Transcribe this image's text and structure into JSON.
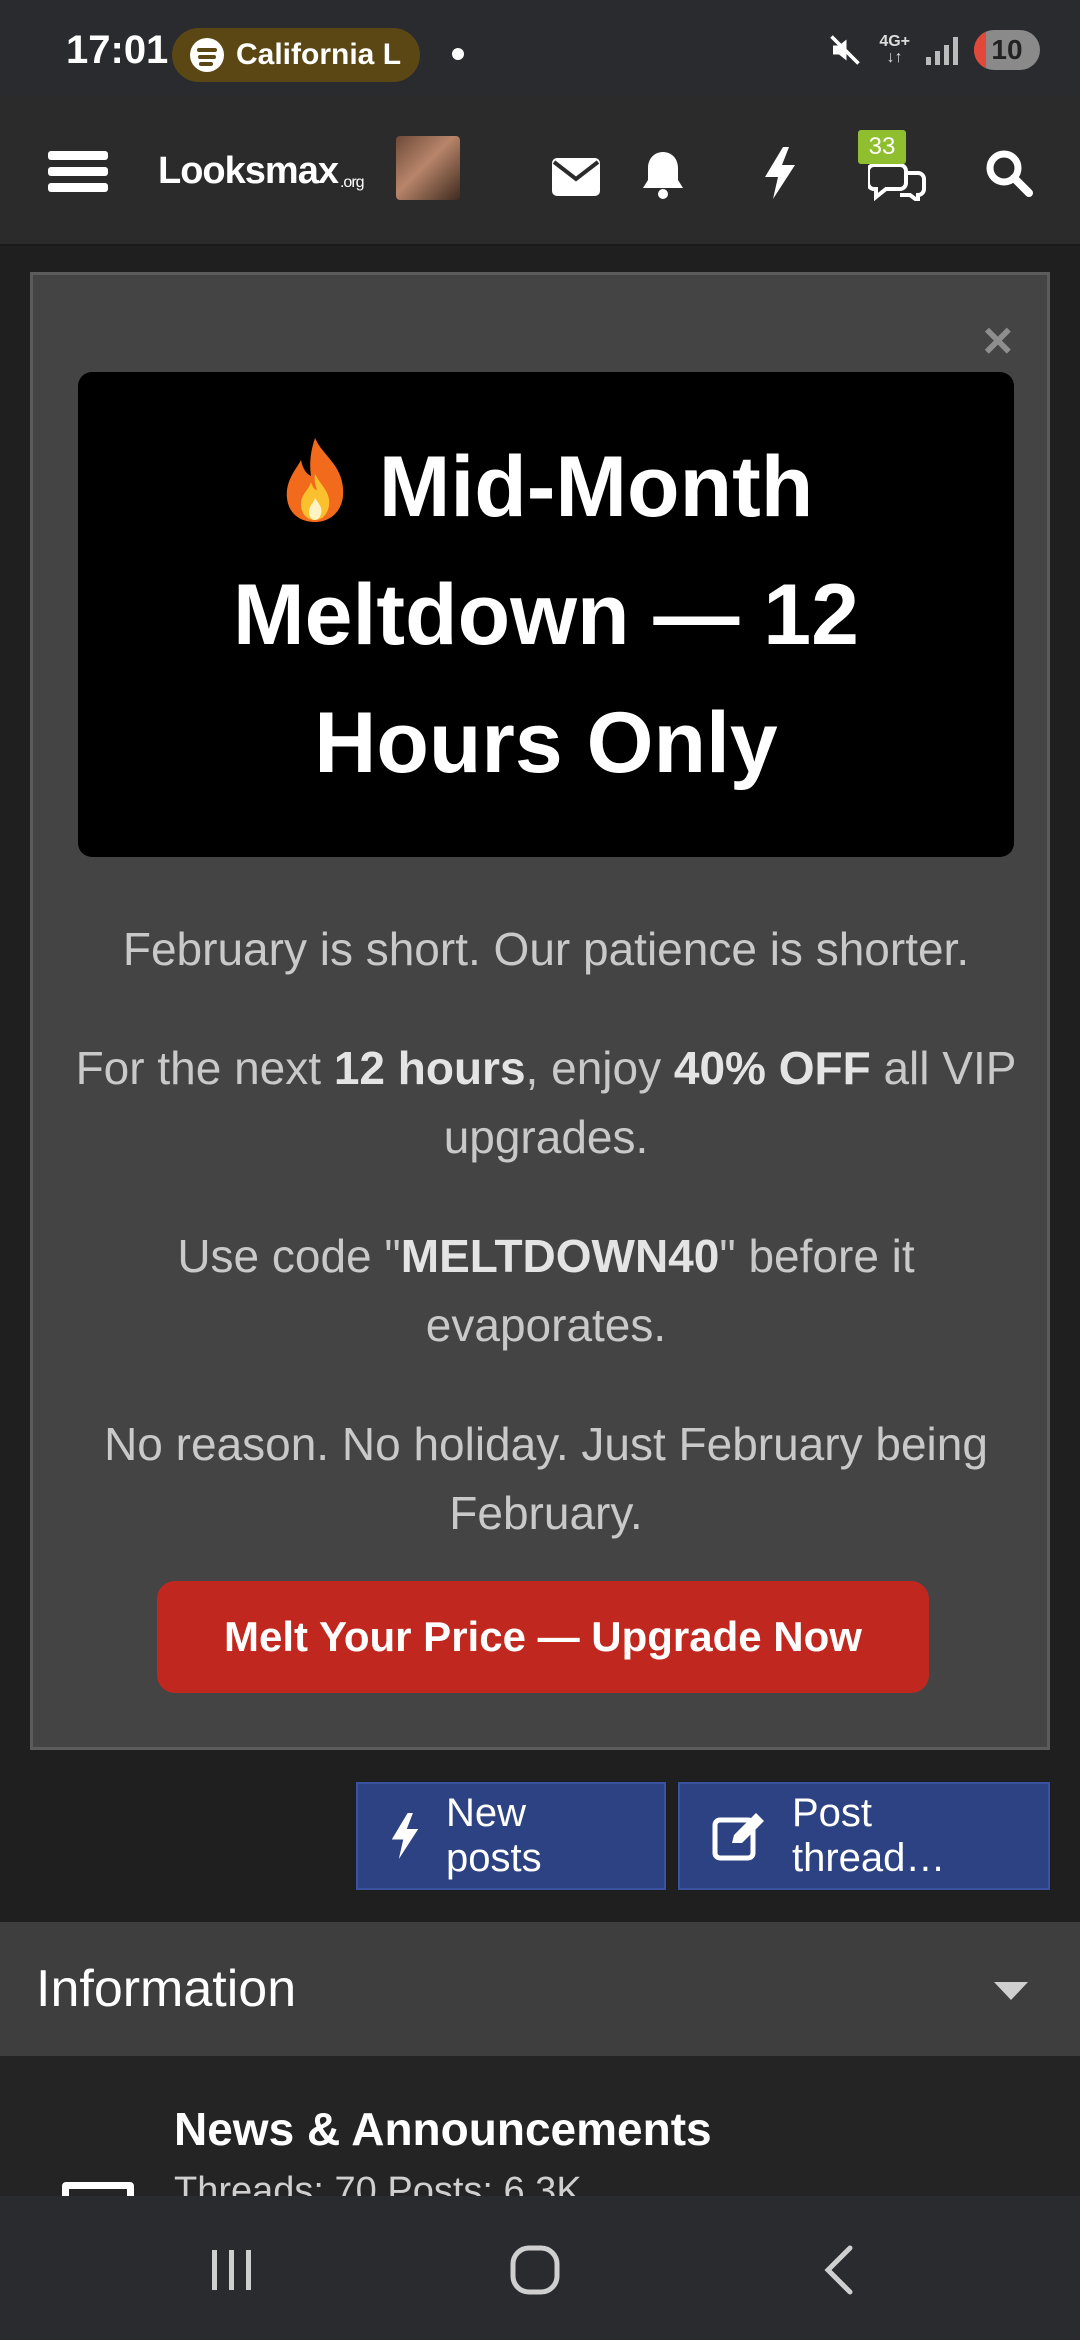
{
  "status_bar": {
    "time": "17:01",
    "now_playing": "California L",
    "network": "4G+",
    "battery": "10"
  },
  "nav": {
    "logo_text": "Looksmax",
    "logo_suffix": ".org",
    "messages_badge": "33",
    "icons": [
      "menu-icon",
      "envelope-icon",
      "bell-icon",
      "lightning-icon",
      "conversations-icon",
      "search-icon"
    ]
  },
  "promo": {
    "title": "Mid-Month Meltdown — 12 Hours Only",
    "line1": "February is short. Our patience is shorter.",
    "line2_pre": "For the next ",
    "line2_hours": "12 hours",
    "line2_mid": ", enjoy ",
    "line2_discount": "40% OFF",
    "line2_post": " all VIP upgrades.",
    "line3_pre": "Use code \"",
    "line3_code": "MELTDOWN40",
    "line3_post": "\" before it evaporates.",
    "line4": "No reason. No holiday. Just February being February.",
    "cta_label": "Melt Your Price — Upgrade Now",
    "close_label": "×",
    "accent_color": "#c0281f"
  },
  "actions": {
    "new_posts_label": "New posts",
    "post_thread_label": "Post thread…"
  },
  "section": {
    "title": "Information"
  },
  "forum": {
    "title": "News & Announcements",
    "stats": "Threads: 70 Posts: 6.3K"
  }
}
